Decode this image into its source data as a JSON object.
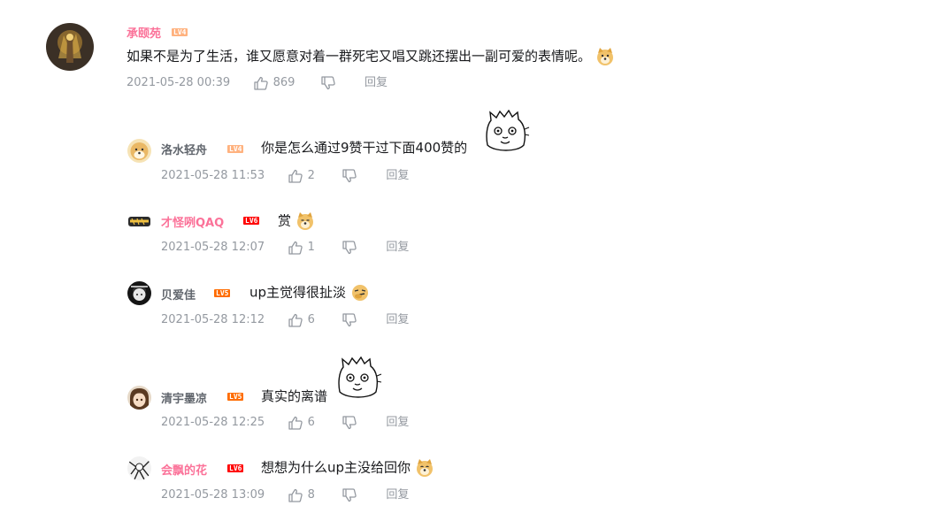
{
  "main_comment": {
    "username": "承颐苑",
    "level": "LV4",
    "text": "如果不是为了生活，谁又愿意对着一群死宅又唱又跳还摆出一副可爱的表情呢。",
    "time": "2021-05-28 00:39",
    "likes": "869",
    "reply_label": "回复"
  },
  "replies": [
    {
      "username": "洛水轻舟",
      "level": "LV4",
      "text": "你是怎么通过9赞干过下面400赞的",
      "time": "2021-05-28 11:53",
      "likes": "2",
      "reply_label": "回复"
    },
    {
      "username": "才怪咧QAQ",
      "level": "LV6",
      "text": "赏",
      "time": "2021-05-28 12:07",
      "likes": "1",
      "reply_label": "回复"
    },
    {
      "username": "贝爱佳",
      "level": "LV5",
      "text": "up主觉得很扯淡",
      "time": "2021-05-28 12:12",
      "likes": "6",
      "reply_label": "回复"
    },
    {
      "username": "清宇墨凉",
      "level": "LV5",
      "text": "真实的离谱",
      "time": "2021-05-28 12:25",
      "likes": "6",
      "reply_label": "回复"
    },
    {
      "username": "会飘的花",
      "level": "LV6",
      "text": "想想为什么up主没给回你",
      "time": "2021-05-28 13:09",
      "likes": "8",
      "reply_label": "回复"
    }
  ],
  "colors": {
    "vip_name": "#fb7299",
    "normal_name": "#61666d",
    "meta": "#9499a0",
    "lv4": "#ffb27f",
    "lv5": "#ff6c00",
    "lv6": "#ff0000"
  },
  "icons": [
    "thumbs-up-icon",
    "thumbs-down-icon",
    "doge-emoji",
    "cat-doodle-sticker"
  ]
}
